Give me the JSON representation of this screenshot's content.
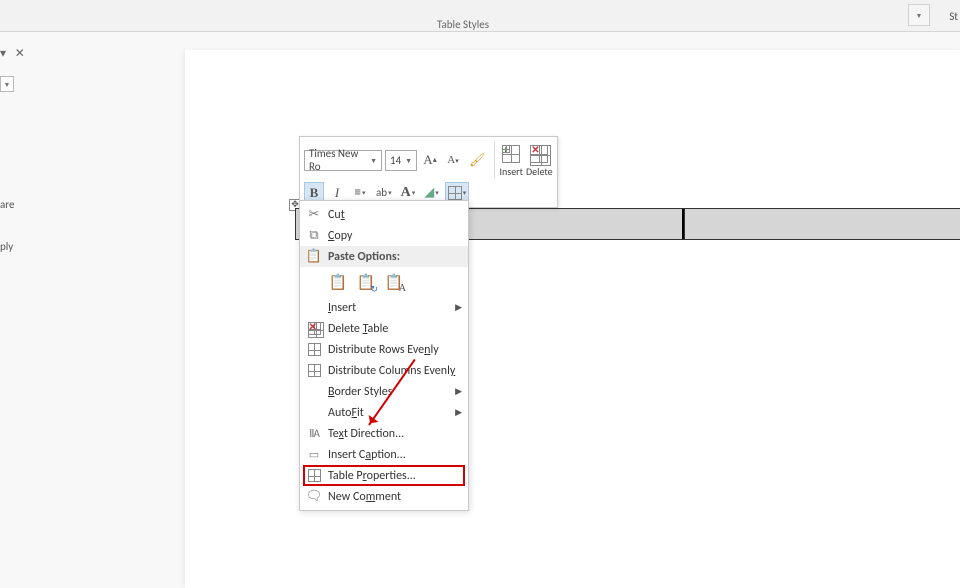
{
  "ribbon": {
    "group_label": "Table Styles",
    "truncated_right": "St"
  },
  "sidebar": {
    "txt1": "are",
    "txt2": "ply"
  },
  "mini": {
    "font_name": "Times New Ro",
    "font_size": "14",
    "insert_label": "Insert",
    "delete_label": "Delete"
  },
  "context_menu": {
    "cut": "Cut",
    "copy": "Copy",
    "paste_header": "Paste Options:",
    "insert": "Insert",
    "delete_table": "Delete Table",
    "dist_rows": "Distribute Rows Evenly",
    "dist_cols": "Distribute Columns Evenly",
    "border_styles": "Border Styles",
    "autofit": "AutoFit",
    "text_direction": "Text Direction...",
    "insert_caption": "Insert Caption...",
    "table_properties": "Table Properties...",
    "new_comment": "New Comment"
  }
}
